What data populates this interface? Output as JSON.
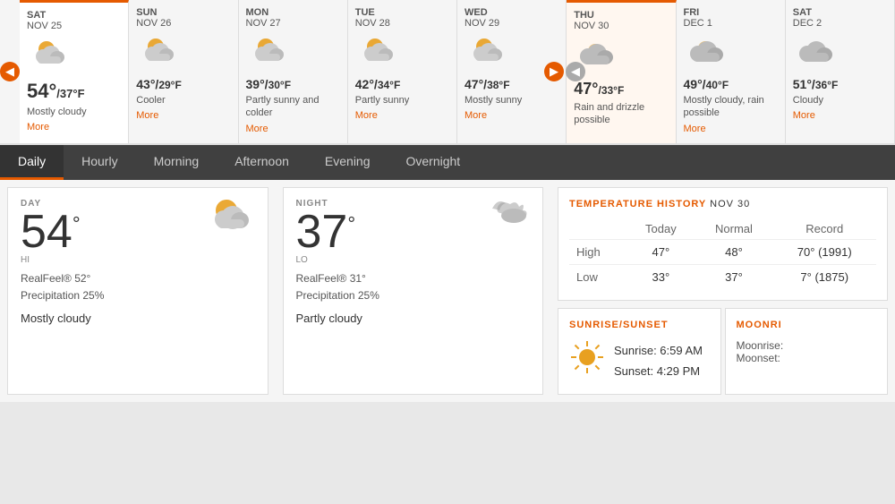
{
  "forecast": {
    "days": [
      {
        "day": "SAT",
        "date": "NOV 25",
        "high": "54°",
        "low": "37°",
        "highSup": "",
        "lowSup": "",
        "desc": "Mostly cloudy",
        "more": "More",
        "active": true,
        "icon": "partly-cloudy"
      },
      {
        "day": "SUN",
        "date": "NOV 26",
        "high": "43°",
        "low": "29°",
        "desc": "Cooler",
        "more": "More",
        "active": false,
        "icon": "partly-cloudy"
      },
      {
        "day": "MON",
        "date": "NOV 27",
        "high": "39°",
        "low": "30°",
        "desc": "Partly sunny and colder",
        "more": "More",
        "active": false,
        "icon": "partly-cloudy"
      },
      {
        "day": "TUE",
        "date": "NOV 28",
        "high": "42°",
        "low": "34°",
        "desc": "Partly sunny",
        "more": "More",
        "active": false,
        "icon": "partly-cloudy"
      },
      {
        "day": "WED",
        "date": "NOV 29",
        "high": "47°",
        "low": "38°",
        "desc": "Mostly sunny",
        "more": "More",
        "active": false,
        "icon": "partly-cloudy"
      },
      {
        "day": "THU",
        "date": "NOV 30",
        "high": "47°",
        "low": "33°",
        "desc": "Rain and drizzle possible",
        "more": "",
        "active": true,
        "highlighted": true,
        "icon": "mostly-cloudy"
      },
      {
        "day": "FRI",
        "date": "DEC 1",
        "high": "49°",
        "low": "40°",
        "desc": "Mostly cloudy, rain possible",
        "more": "More",
        "active": false,
        "icon": "mostly-cloudy"
      },
      {
        "day": "SAT",
        "date": "DEC 2",
        "high": "51°",
        "low": "36°",
        "desc": "Cloudy",
        "more": "More",
        "active": false,
        "icon": "cloudy"
      }
    ]
  },
  "tabs": [
    "Daily",
    "Hourly",
    "Morning",
    "Afternoon",
    "Evening",
    "Overnight"
  ],
  "active_tab": "Daily",
  "day_card": {
    "label": "DAY",
    "temp": "54",
    "unit": "°",
    "sublabel": "HI",
    "realfeel": "RealFeel® 52°",
    "precipitation": "Precipitation 25%",
    "condition": "Mostly cloudy"
  },
  "night_card": {
    "label": "NIGHT",
    "temp": "37",
    "unit": "°",
    "sublabel": "LO",
    "realfeel": "RealFeel® 31°",
    "precipitation": "Precipitation 25%",
    "condition": "Partly cloudy"
  },
  "temp_history": {
    "title": "TEMPERATURE HISTORY",
    "date": "NOV 30",
    "headers": [
      "",
      "Today",
      "Normal",
      "Record"
    ],
    "rows": [
      {
        "label": "High",
        "today": "47°",
        "normal": "48°",
        "record": "70° (1991)"
      },
      {
        "label": "Low",
        "today": "33°",
        "normal": "37°",
        "record": "7° (1875)"
      }
    ]
  },
  "sunrise_sunset": {
    "title": "SUNRISE/SUNSET",
    "sunrise": "Sunrise: 6:59 AM",
    "sunset": "Sunset: 4:29 PM"
  },
  "moonrise": {
    "title": "MOONRI"
  }
}
